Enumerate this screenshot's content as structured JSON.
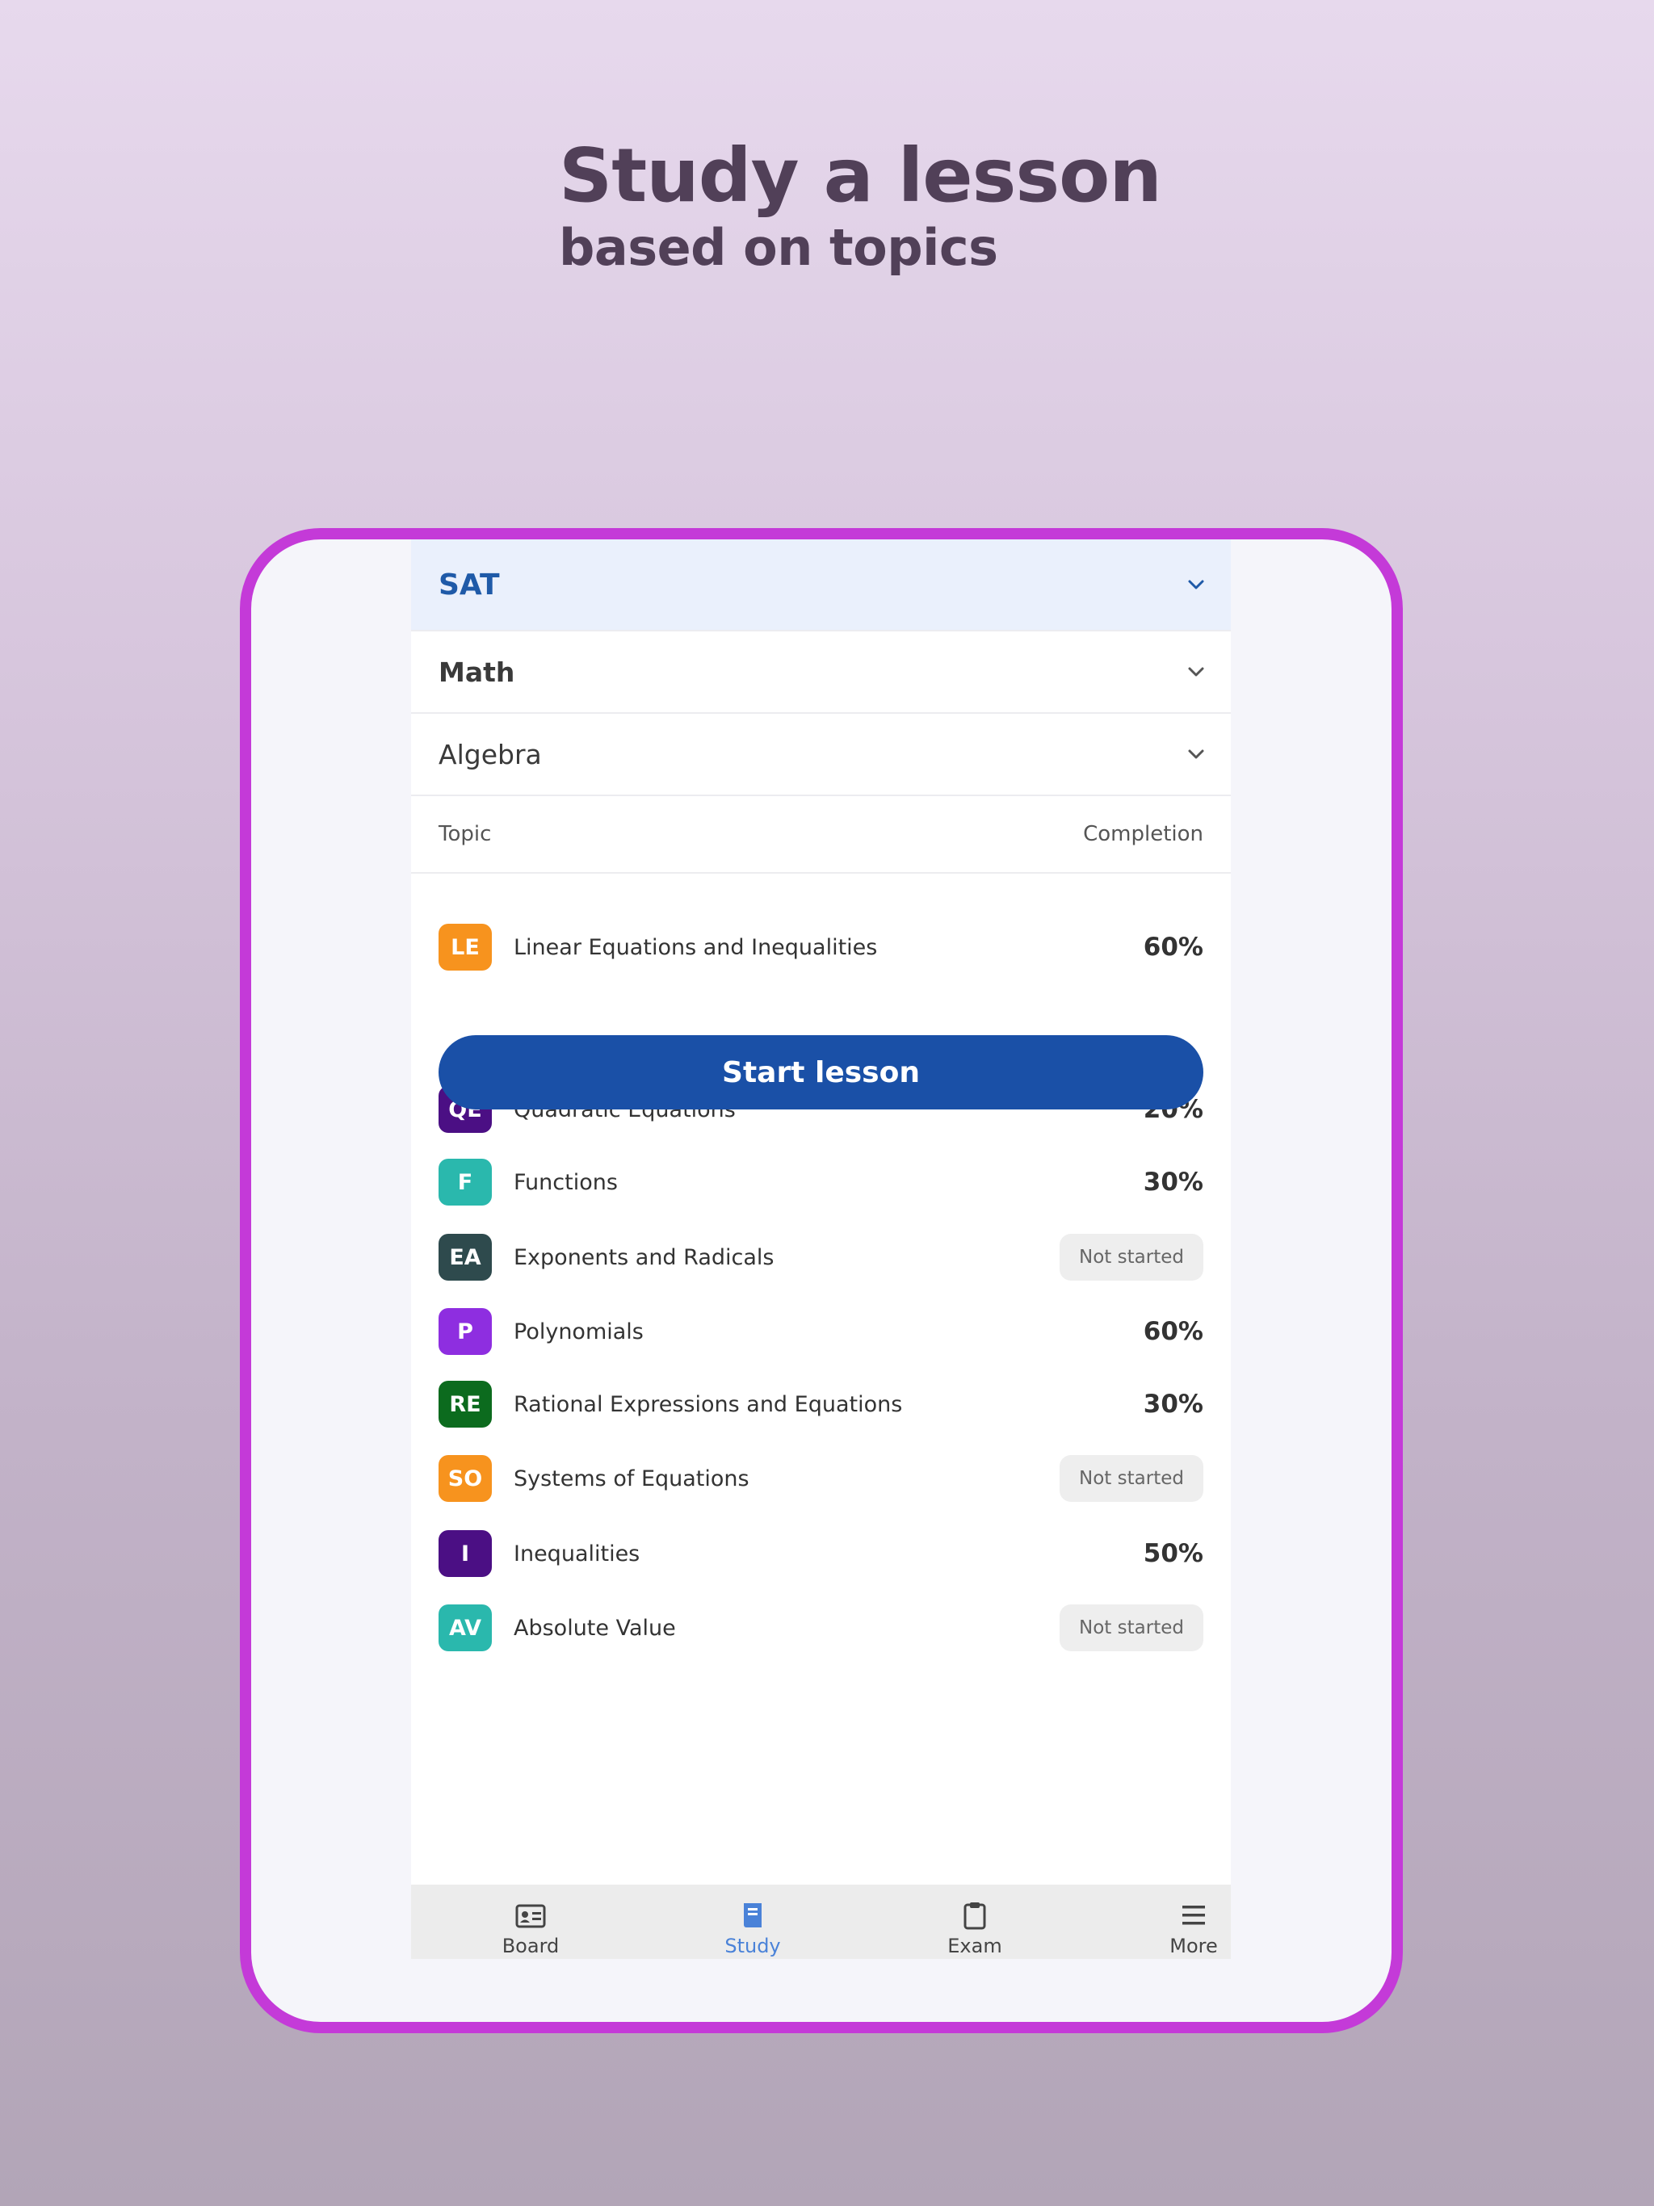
{
  "headline": {
    "title": "Study a lesson",
    "subtitle": "based on topics"
  },
  "selectors": {
    "exam": "SAT",
    "subject": "Math",
    "chapter": "Algebra"
  },
  "table": {
    "col_topic": "Topic",
    "col_completion": "Completion"
  },
  "start_lesson_label": "Start lesson",
  "topics": [
    {
      "initials": "LE",
      "name": "Linear Equations and Inequalities",
      "completion": "60%",
      "color": "#f7931e"
    },
    {
      "initials": "QE",
      "name": "Quadratic Equations",
      "completion": "20%",
      "color": "#4b0f84"
    },
    {
      "initials": "F",
      "name": "Functions",
      "completion": "30%",
      "color": "#2ab8ad"
    },
    {
      "initials": "EA",
      "name": "Exponents and Radicals",
      "completion": "Not started",
      "color": "#2e4a4d"
    },
    {
      "initials": "P",
      "name": "Polynomials",
      "completion": "60%",
      "color": "#8e2ee0"
    },
    {
      "initials": "RE",
      "name": "Rational Expressions and Equations",
      "completion": "30%",
      "color": "#0c6b1e"
    },
    {
      "initials": "SO",
      "name": "Systems of Equations",
      "completion": "Not started",
      "color": "#f7931e"
    },
    {
      "initials": "I",
      "name": "Inequalities",
      "completion": "50%",
      "color": "#4b0f84"
    },
    {
      "initials": "AV",
      "name": "Absolute Value",
      "completion": "Not started",
      "color": "#2ab8ad"
    }
  ],
  "tabs": {
    "board": "Board",
    "study": "Study",
    "exam": "Exam",
    "more": "More"
  },
  "colors": {
    "frame": "#c43ad8",
    "primary": "#1a50a7",
    "active_tab": "#4a82d8"
  }
}
